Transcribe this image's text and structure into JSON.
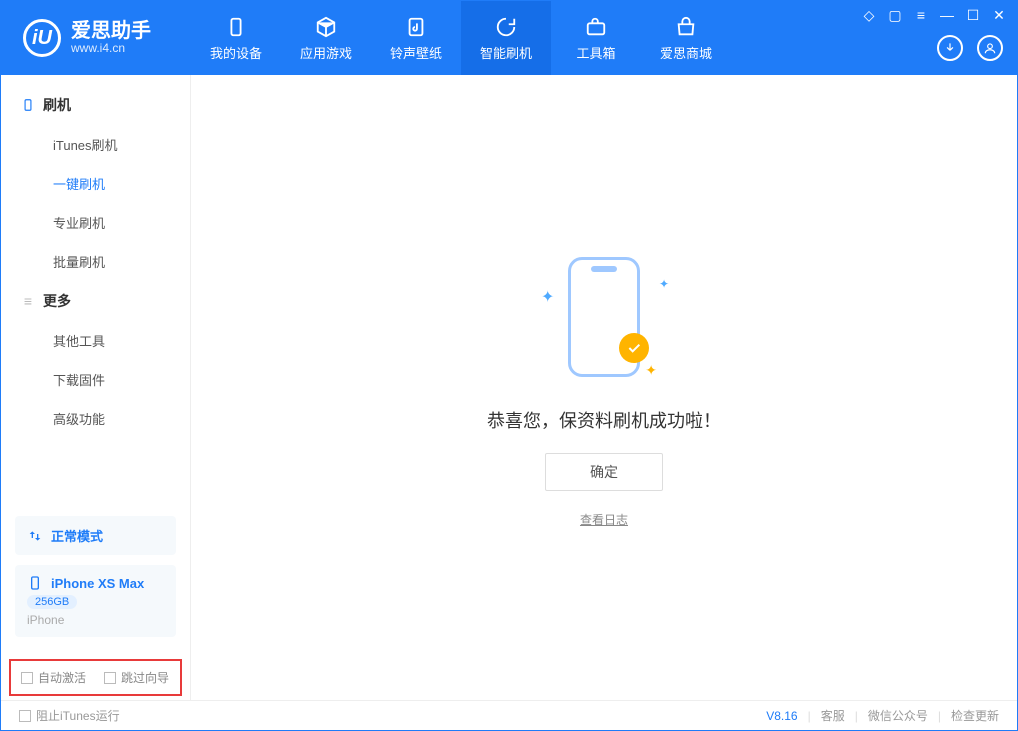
{
  "app": {
    "name": "爱思助手",
    "url": "www.i4.cn"
  },
  "tabs": [
    {
      "label": "我的设备"
    },
    {
      "label": "应用游戏"
    },
    {
      "label": "铃声壁纸"
    },
    {
      "label": "智能刷机"
    },
    {
      "label": "工具箱"
    },
    {
      "label": "爱思商城"
    }
  ],
  "sidebar": {
    "section1": {
      "title": "刷机",
      "items": [
        "iTunes刷机",
        "一键刷机",
        "专业刷机",
        "批量刷机"
      ]
    },
    "section2": {
      "title": "更多",
      "items": [
        "其他工具",
        "下载固件",
        "高级功能"
      ]
    }
  },
  "mode_panel": {
    "label": "正常模式"
  },
  "device_panel": {
    "name": "iPhone XS Max",
    "storage": "256GB",
    "type": "iPhone"
  },
  "options": {
    "auto_activate": "自动激活",
    "skip_wizard": "跳过向导"
  },
  "main": {
    "success_title": "恭喜您，保资料刷机成功啦！",
    "ok_btn": "确定",
    "view_log": "查看日志"
  },
  "status": {
    "stop_itunes": "阻止iTunes运行",
    "version": "V8.16",
    "svc": "客服",
    "wechat": "微信公众号",
    "update": "检查更新"
  }
}
